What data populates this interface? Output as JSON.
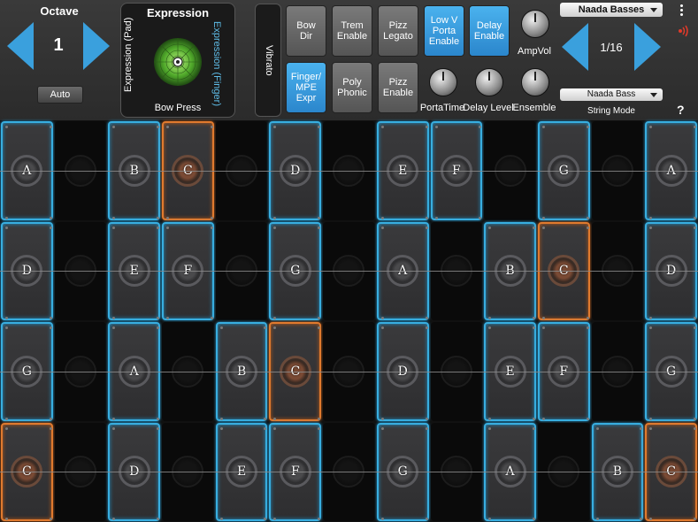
{
  "octave": {
    "title": "Octave",
    "value": "1",
    "auto_label": "Auto"
  },
  "expression": {
    "title": "Expression",
    "pad_label": "Expression (Pad)",
    "finger_label": "Expression (Finger)",
    "bow_press_label": "Bow Press"
  },
  "vibrato": {
    "label": "Vibrato"
  },
  "buttons": {
    "bow_dir": "Bow\nDir",
    "trem_enable": "Trem\nEnable",
    "pizz_legato": "Pizz\nLegato",
    "low_v_porta_enable": "Low V\nPorta\nEnable",
    "delay_enable": "Delay\nEnable",
    "finger_mpe_expr": "Finger/\nMPE\nExpr",
    "poly_phonic": "Poly\nPhonic",
    "pizz_enable": "Pizz\nEnable"
  },
  "knobs": {
    "ampvol": "AmpVol",
    "portatime": "PortaTime",
    "delay_level": "Delay Level",
    "ensemble": "Ensemble"
  },
  "preset": {
    "name": "Naada Basses",
    "page": "1/16"
  },
  "string_mode": {
    "value": "Naada Bass",
    "label": "String Mode"
  },
  "help": "?",
  "colors": {
    "accent": "#3aa0dd",
    "root": "#e07a2e",
    "panel": "#333333"
  },
  "grid": {
    "rows": [
      [
        "A",
        null,
        "B",
        "C",
        null,
        "D",
        null,
        "E",
        "F",
        null,
        "G",
        null,
        "A"
      ],
      [
        "D",
        null,
        "E",
        "F",
        null,
        "G",
        null,
        "A",
        null,
        "B",
        "C",
        null,
        "D"
      ],
      [
        "G",
        null,
        "A",
        null,
        "B",
        "C",
        null,
        "D",
        null,
        "E",
        "F",
        null,
        "G"
      ],
      [
        "C",
        null,
        "D",
        null,
        "E",
        "F",
        null,
        "G",
        null,
        "A",
        null,
        "B",
        "C"
      ]
    ],
    "root_note": "C"
  }
}
